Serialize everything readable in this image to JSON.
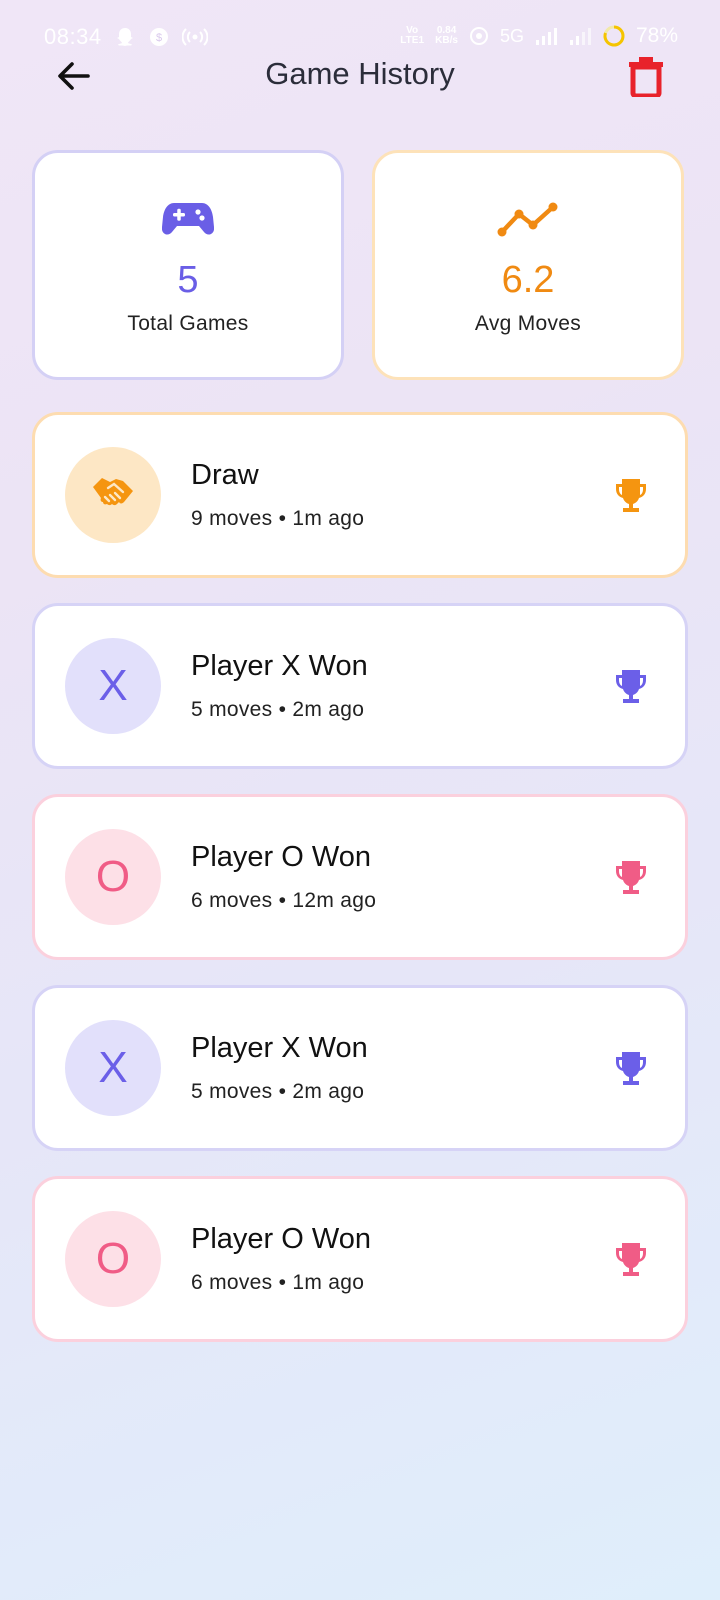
{
  "status_bar": {
    "time": "08:34",
    "network_type": "5G",
    "volte_label": "Vo LTE1",
    "speed_value": "0.84",
    "speed_unit": "KB/s",
    "battery": "78%"
  },
  "header": {
    "title": "Game History",
    "back_icon": "arrow-left-icon",
    "delete_icon": "trash-icon"
  },
  "stats": {
    "total_games": {
      "value": "5",
      "label": "Total Games",
      "icon": "gamepad-icon",
      "color": "#6a5ee6"
    },
    "avg_moves": {
      "value": "6.2",
      "label": "Avg Moves",
      "icon": "trend-line-icon",
      "color": "#f08a12"
    }
  },
  "history": [
    {
      "type": "draw",
      "avatar": "",
      "avatar_icon": "handshake-icon",
      "title": "Draw",
      "subtitle": "9 moves • 1m ago",
      "color": "#f59510"
    },
    {
      "type": "x",
      "avatar": "X",
      "title": "Player X Won",
      "subtitle": "5 moves • 2m ago",
      "color": "#6b5fe8"
    },
    {
      "type": "o",
      "avatar": "O",
      "title": "Player O Won",
      "subtitle": "6 moves • 12m ago",
      "color": "#f05c86"
    },
    {
      "type": "x",
      "avatar": "X",
      "title": "Player X Won",
      "subtitle": "5 moves • 2m ago",
      "color": "#6b5fe8"
    },
    {
      "type": "o",
      "avatar": "O",
      "title": "Player O Won",
      "subtitle": "6 moves • 1m ago",
      "color": "#f05c86"
    }
  ],
  "colors": {
    "delete_red": "#e8222b",
    "title_text": "#2b2d3a"
  }
}
